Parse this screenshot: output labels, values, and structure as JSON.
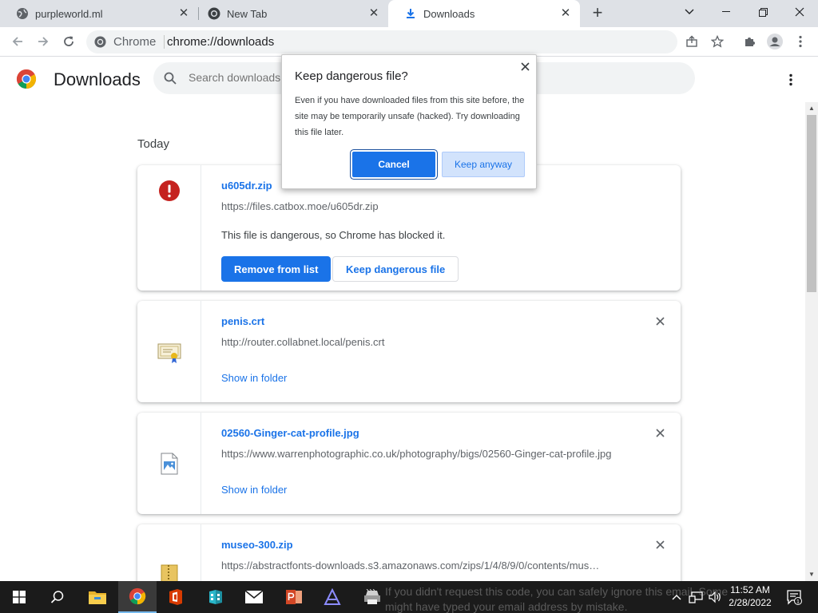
{
  "tabs": [
    {
      "title": "purpleworld.ml",
      "icon": "globe-icon"
    },
    {
      "title": "New Tab",
      "icon": "chrome-icon"
    },
    {
      "title": "Downloads",
      "icon": "download-icon"
    }
  ],
  "toolbar": {
    "site_label": "Chrome",
    "url": "chrome://downloads"
  },
  "downloads_page": {
    "title": "Downloads",
    "search_placeholder": "Search downloads",
    "section_today": "Today"
  },
  "downloads": [
    {
      "name": "u605dr.zip",
      "url": "https://files.catbox.moe/u605dr.zip",
      "status": "This file is dangerous, so Chrome has blocked it.",
      "primary_action": "Remove from list",
      "secondary_action": "Keep dangerous file",
      "icon": "danger-icon"
    },
    {
      "name": "penis.crt",
      "url": "http://router.collabnet.local/penis.crt",
      "link": "Show in folder",
      "icon": "certificate-icon"
    },
    {
      "name": "02560-Ginger-cat-profile.jpg",
      "url": "https://www.warrenphotographic.co.uk/photography/bigs/02560-Ginger-cat-profile.jpg",
      "link": "Show in folder",
      "icon": "image-file-icon"
    },
    {
      "name": "museo-300.zip",
      "url": "https://abstractfonts-downloads.s3.amazonaws.com/zips/1/4/8/9/0/contents/mus…",
      "icon": "zip-file-icon"
    }
  ],
  "dialog": {
    "title": "Keep dangerous file?",
    "body": "Even if you have downloaded files from this site before, the site may be temporarily unsafe (hacked). Try downloading this file later.",
    "cancel_label": "Cancel",
    "keep_label": "Keep anyway"
  },
  "taskbar": {
    "bleed_line1": "If you didn't request this code, you can safely ignore this email. Some",
    "bleed_line2": "might have typed your email address by mistake.",
    "time": "11:52 AM",
    "date": "2/28/2022",
    "notification_count": "1"
  },
  "colors": {
    "accent": "#1a73e8",
    "danger": "#c5221f",
    "tabstrip": "#dee1e6",
    "taskbar": "#1b1b1b"
  }
}
